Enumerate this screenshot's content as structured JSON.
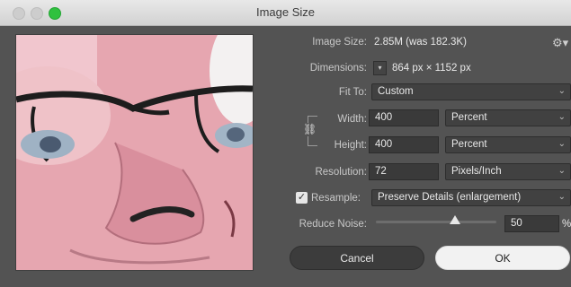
{
  "window": {
    "title": "Image Size"
  },
  "info": {
    "image_size_label": "Image Size:",
    "image_size_value": "2.85M (was 182.3K)",
    "dimensions_label": "Dimensions:",
    "dimensions_value": "864 px  ×  1152 px"
  },
  "fit_to": {
    "label": "Fit To:",
    "value": "Custom"
  },
  "width": {
    "label": "Width:",
    "value": "400",
    "unit": "Percent"
  },
  "height": {
    "label": "Height:",
    "value": "400",
    "unit": "Percent"
  },
  "resolution": {
    "label": "Resolution:",
    "value": "72",
    "unit": "Pixels/Inch"
  },
  "resample": {
    "label": "Resample:",
    "value": "Preserve Details (enlargement)",
    "checked": true
  },
  "reduce_noise": {
    "label": "Reduce Noise:",
    "value": "50",
    "unit": "%",
    "level_percent": 50
  },
  "buttons": {
    "cancel": "Cancel",
    "ok": "OK"
  },
  "icons": {
    "gear": "gear-icon",
    "link": "chain-link-icon",
    "dimensions_menu": "chevron-down-icon"
  }
}
